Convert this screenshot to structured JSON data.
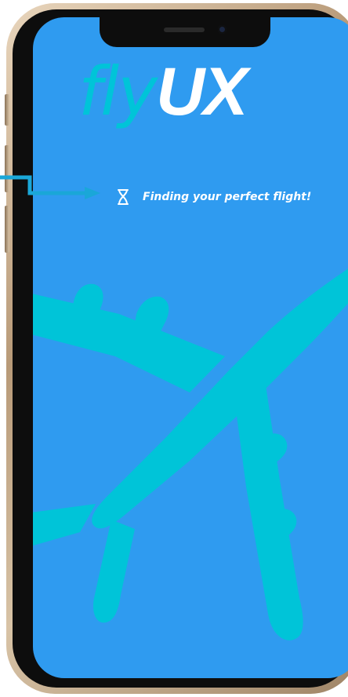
{
  "app": {
    "logo_fly": "fly",
    "logo_ux": "UX"
  },
  "loading": {
    "message": "Finding your perfect flight!",
    "icon": "hourglass-icon"
  },
  "colors": {
    "screen_background": "#2f9bf0",
    "accent_cyan": "#00c4d8",
    "text_white": "#ffffff",
    "annotation_arrow": "#1aa7d8"
  },
  "decorations": {
    "background_graphic": "airplane-silhouette",
    "annotation": "pointer-arrow"
  }
}
